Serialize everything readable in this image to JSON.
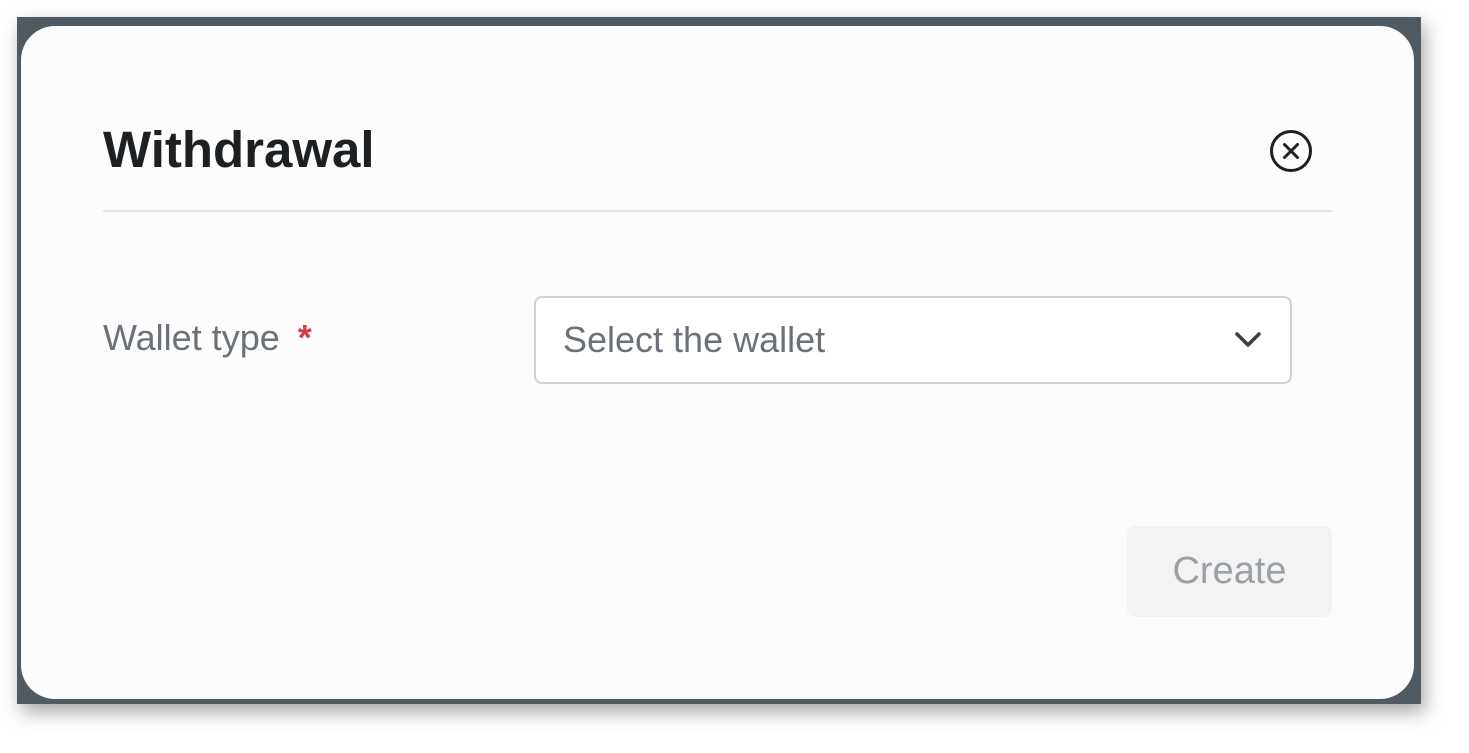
{
  "dialog": {
    "title": "Withdrawal",
    "close_icon": "close-circle-icon"
  },
  "form": {
    "wallet_type": {
      "label": "Wallet type",
      "required_mark": "*",
      "placeholder": "Select the wallet",
      "value": "",
      "dropdown_icon": "chevron-down-icon"
    }
  },
  "actions": {
    "create_label": "Create",
    "create_disabled": true
  },
  "colors": {
    "backdrop": "#4f5a63",
    "modal_bg": "#fcfcfc",
    "title": "#1d2023",
    "label": "#6a7178",
    "required": "#d23f4a",
    "button_bg_disabled": "#f3f3f4",
    "button_text_disabled": "#9aa0a6"
  }
}
